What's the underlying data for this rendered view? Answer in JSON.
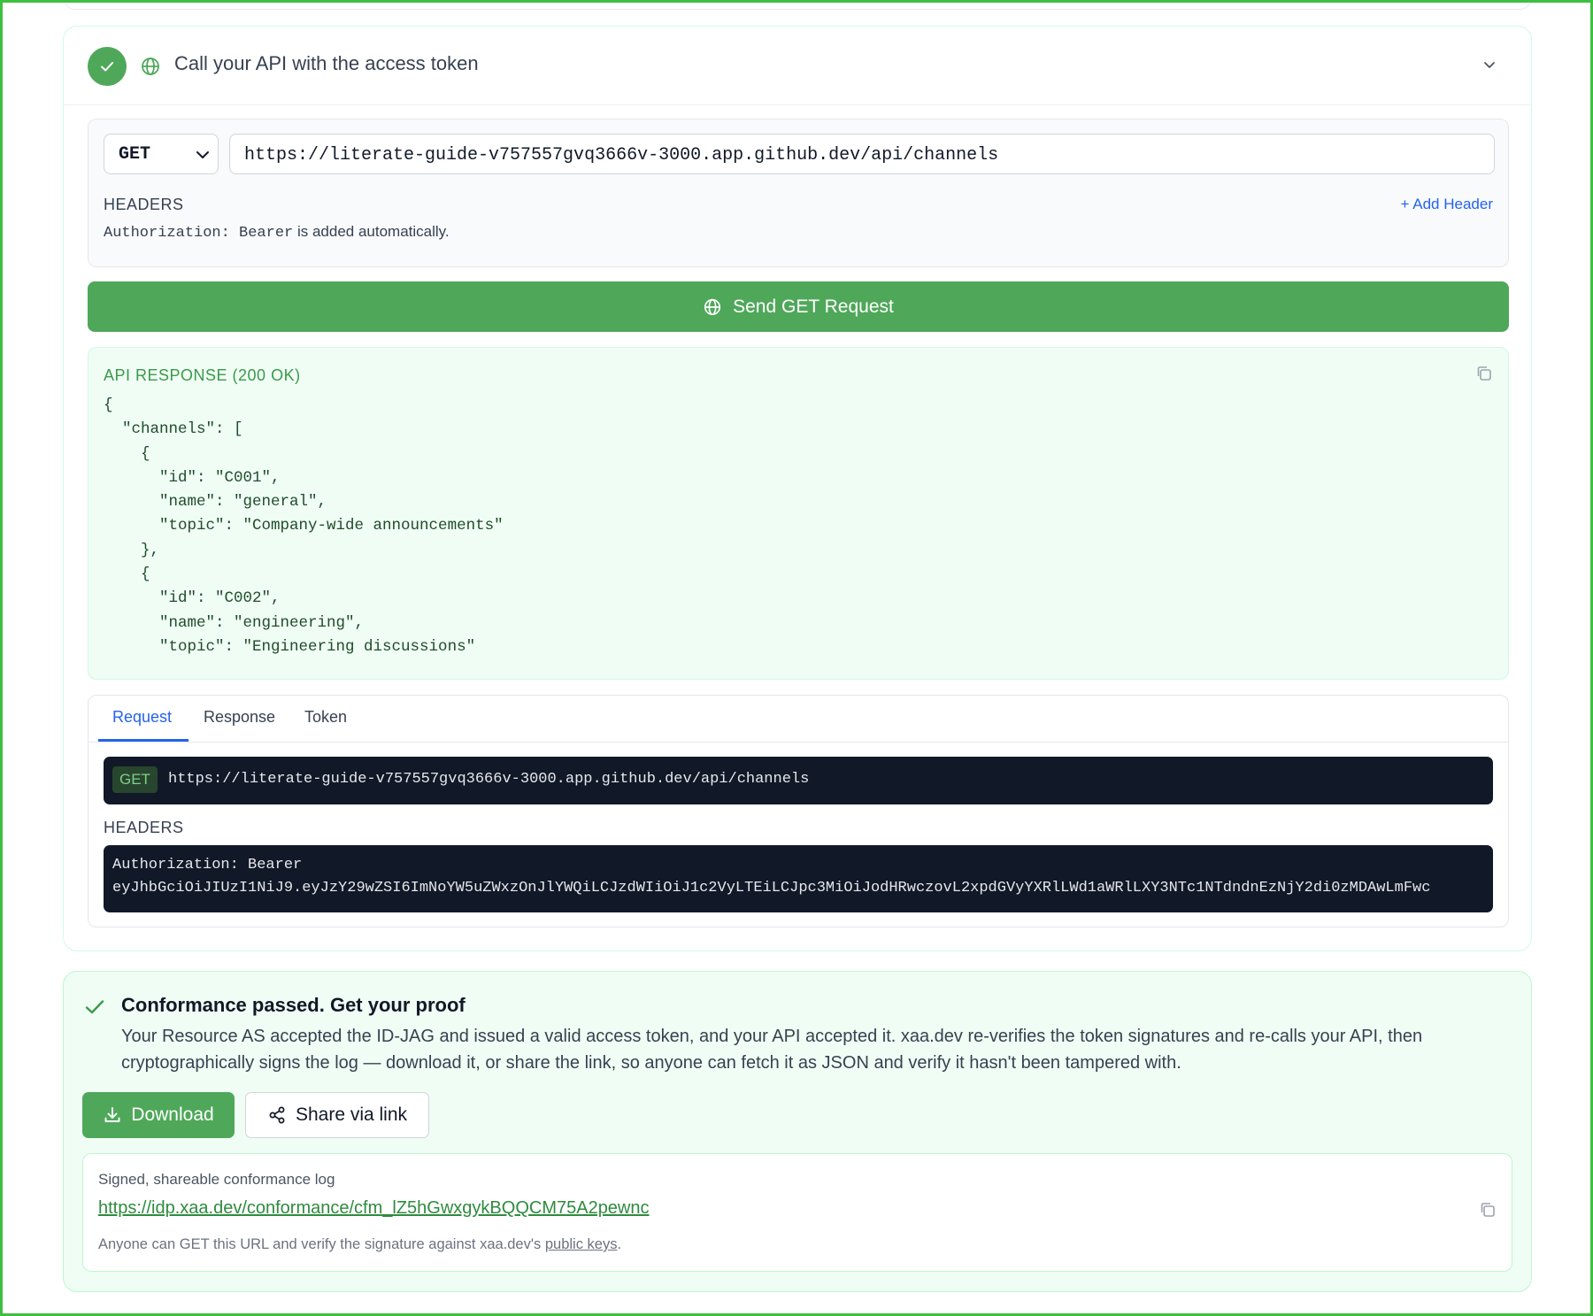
{
  "step": {
    "title": "Call your API with the access token"
  },
  "builder": {
    "method": "GET",
    "url": "https://literate-guide-v757557gvq3666v-3000.app.github.dev/api/channels",
    "headers_label": "HEADERS",
    "add_header": "+ Add Header",
    "auth_code": "Authorization: Bearer",
    "auth_suffix": " is added automatically."
  },
  "send_button": "Send GET Request",
  "response": {
    "label": "API RESPONSE (200 OK)",
    "body": "{\n  \"channels\": [\n    {\n      \"id\": \"C001\",\n      \"name\": \"general\",\n      \"topic\": \"Company-wide announcements\"\n    },\n    {\n      \"id\": \"C002\",\n      \"name\": \"engineering\",\n      \"topic\": \"Engineering discussions\""
  },
  "tabs": [
    {
      "label": "Request",
      "active": true
    },
    {
      "label": "Response",
      "active": false
    },
    {
      "label": "Token",
      "active": false
    }
  ],
  "request_detail": {
    "method_badge": "GET",
    "url": "https://literate-guide-v757557gvq3666v-3000.app.github.dev/api/channels",
    "headers_label": "HEADERS",
    "auth_line1": "Authorization: Bearer",
    "auth_line2": "eyJhbGciOiJIUzI1NiJ9.eyJzY29wZSI6ImNoYW5uZWxzOnJlYWQiLCJzdWIiOiJ1c2VyLTEiLCJpc3MiOiJodHRwczovL2xpdGVyYXRlLWd1aWRlLXY3NTc1NTdndnEzNjY2di0zMDAwLmFwc"
  },
  "conformance": {
    "title": "Conformance passed. Get your proof",
    "description": "Your Resource AS accepted the ID-JAG and issued a valid access token, and your API accepted it. xaa.dev re-verifies the token signatures and re-calls your API, then cryptographically signs the log — download it, or share the link, so anyone can fetch it as JSON and verify it hasn't been tampered with.",
    "download_label": "Download",
    "share_label": "Share via link",
    "log_label": "Signed, shareable conformance log",
    "log_url": "https://idp.xaa.dev/conformance/cfm_lZ5hGwxgykBQQCM75A2pewnc",
    "note_prefix": "Anyone can GET this URL and verify the signature against xaa.dev's ",
    "note_link": "public keys",
    "note_suffix": "."
  },
  "colors": {
    "accent_green": "#4fa85a",
    "link_blue": "#2563eb",
    "code_bg": "#111827"
  }
}
